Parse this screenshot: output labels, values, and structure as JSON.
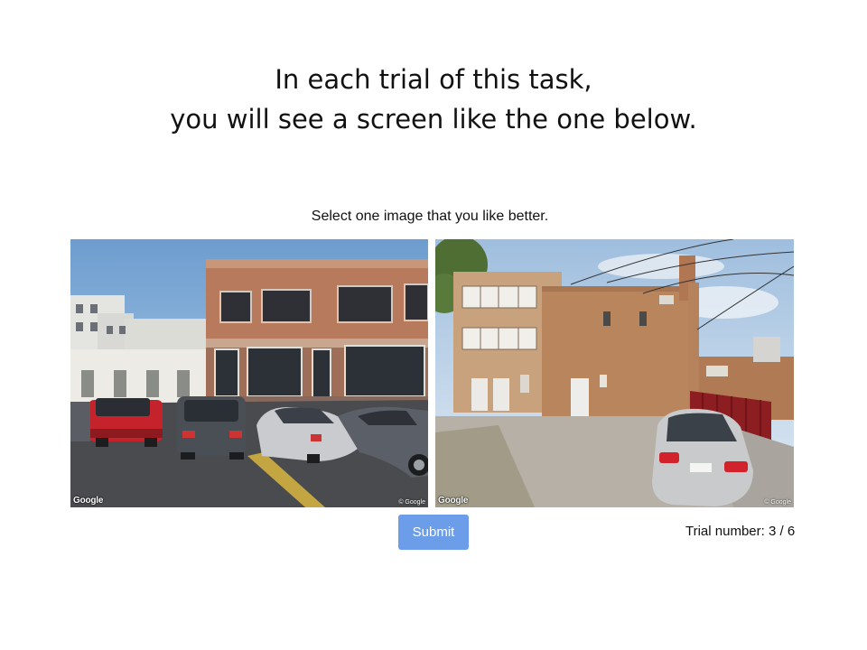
{
  "heading": {
    "line1": "In each trial of this task,",
    "line2": "you will see a screen like the one below."
  },
  "prompt": "Select one image that you like better.",
  "images": [
    {
      "watermark": "Google",
      "copyright": "© Google",
      "icon": "street-view-photo-brick-commercial-building-parking-lot"
    },
    {
      "watermark": "Google",
      "copyright": "© Google",
      "icon": "street-view-photo-brick-building-rear-alley-silver-car"
    }
  ],
  "submit_label": "Submit",
  "trial": {
    "label": "Trial number:",
    "current": 3,
    "total": 6,
    "text": "Trial number: 3 / 6"
  },
  "colors": {
    "submit_button": "#6b9de8",
    "background": "#ffffff"
  }
}
